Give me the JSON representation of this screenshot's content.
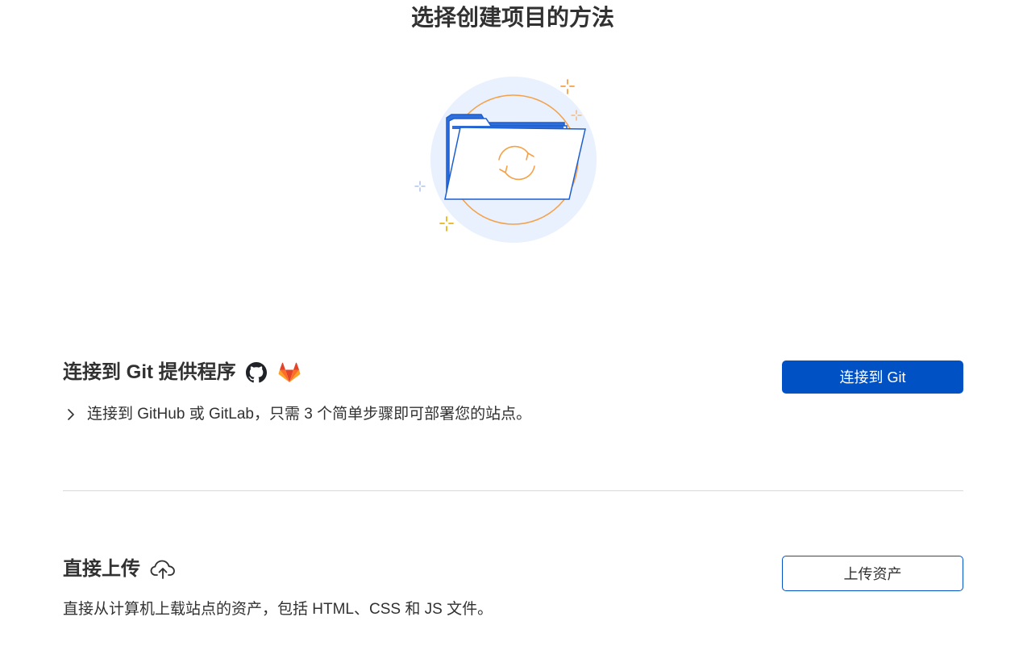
{
  "page": {
    "title": "选择创建项目的方法"
  },
  "git_section": {
    "title": "连接到 Git 提供程序",
    "description": "连接到 GitHub 或 GitLab，只需 3 个简单步骤即可部署您的站点。",
    "button_label": "连接到 Git",
    "icons": [
      "github-icon",
      "gitlab-icon",
      "chevron-right-icon"
    ]
  },
  "upload_section": {
    "title": "直接上传",
    "description": "直接从计算机上载站点的资产，包括 HTML、CSS 和 JS 文件。",
    "button_label": "上传资产",
    "icons": [
      "cloud-upload-icon"
    ]
  },
  "colors": {
    "primary": "#0051c3",
    "text": "#313131",
    "divider": "#d9d9d9",
    "gitlab_orange": "#e24329",
    "illustration_accent": "#f5a14a",
    "illustration_bg": "#e8f1fd"
  }
}
